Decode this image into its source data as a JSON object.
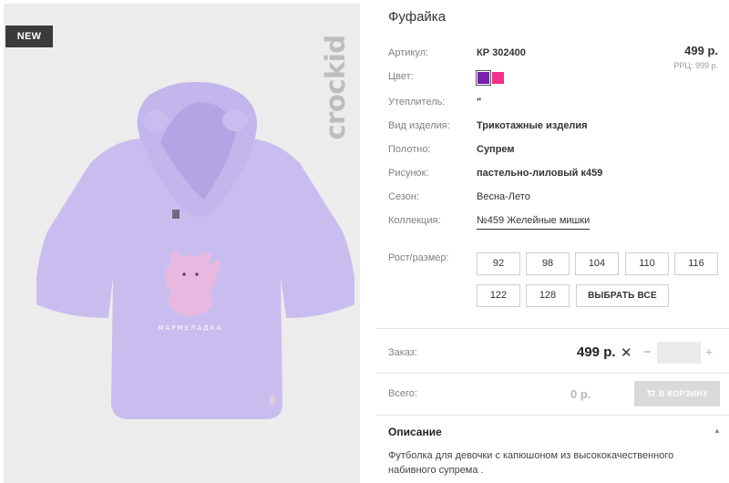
{
  "badge": "NEW",
  "brand": "crockid",
  "product": {
    "title": "Фуфайка",
    "price": "499 р.",
    "rrp": "РРЦ: 999 р."
  },
  "specs": {
    "article_label": "Артикул:",
    "article_value": "КР 302400",
    "color_label": "Цвет:",
    "insulation_label": "Утеплитель:",
    "insulation_value": "\"",
    "type_label": "Вид изделия:",
    "type_value": "Трикотажные изделия",
    "fabric_label": "Полотно:",
    "fabric_value": "Супрем",
    "print_label": "Рисунок:",
    "print_value": "пастельно-лиловый к459",
    "season_label": "Сезон:",
    "season_value": "Весна-Лето",
    "collection_label": "Коллекция:",
    "collection_value": "№459 Желейные мишки"
  },
  "colors": [
    {
      "name": "purple",
      "hex": "#7a1fb0",
      "selected": true
    },
    {
      "name": "pink",
      "hex": "#f0308a",
      "selected": false
    }
  ],
  "sizes": {
    "label": "Рост/размер:",
    "items": [
      "92",
      "98",
      "104",
      "110",
      "116",
      "122",
      "128"
    ],
    "select_all": "ВЫБРАТЬ ВСЕ"
  },
  "order": {
    "label": "Заказ:",
    "price": "499 р.",
    "times": "✕",
    "minus": "−",
    "plus": "+",
    "qty": ""
  },
  "total": {
    "label": "Всего:",
    "value": "0 р.",
    "cart_button": "В КОРЗИНУ"
  },
  "description": {
    "title": "Описание",
    "text": "Футболка для девочки с капюшоном из высококачественного набивного супрема ."
  },
  "shirt_print_text": "МАРМЕЛАДКА",
  "colors_theme": {
    "shirt": "#c9bdf0",
    "shirt_shadow": "#b7a9e6",
    "bear": "#e8b8e0",
    "cart_disabled": "#d9d9d9"
  }
}
